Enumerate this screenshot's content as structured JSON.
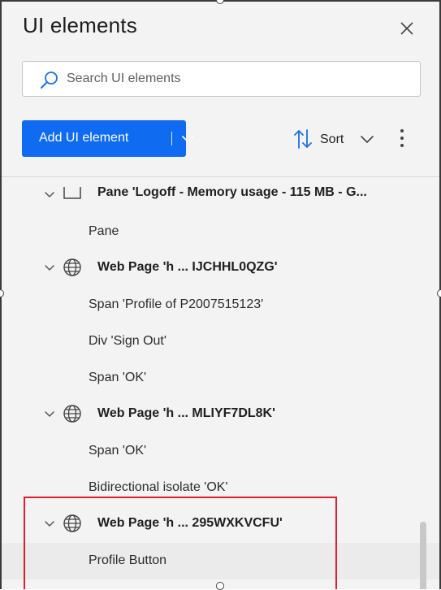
{
  "panel": {
    "title": "UI elements",
    "close_icon": "close-icon"
  },
  "search": {
    "placeholder": "Search UI elements",
    "value": "",
    "icon": "search-icon"
  },
  "toolbar": {
    "add_label": "Add UI element",
    "add_dropdown_icon": "chevron-down-icon",
    "sort_label": "Sort",
    "sort_icon": "sort-arrows-icon",
    "sort_dropdown_icon": "chevron-down-icon",
    "more_icon": "more-vertical-icon",
    "accent_color": "#0f6cf0"
  },
  "tree": {
    "rows": [
      {
        "kind": "parent",
        "icon": "pane-icon",
        "label": "Pane 'Logoff - Memory usage - 115 MB - G..."
      },
      {
        "kind": "child",
        "label": "Pane"
      },
      {
        "kind": "parent",
        "icon": "globe-icon",
        "label": "Web Page 'h ... IJCHHL0QZG'"
      },
      {
        "kind": "child",
        "label": "Span 'Profile of P2007515123'"
      },
      {
        "kind": "child",
        "label": "Div 'Sign Out'"
      },
      {
        "kind": "child",
        "label": "Span 'OK'"
      },
      {
        "kind": "parent",
        "icon": "globe-icon",
        "label": "Web Page 'h ... MLIYF7DL8K'"
      },
      {
        "kind": "child",
        "label": "Span 'OK'"
      },
      {
        "kind": "child",
        "label": "Bidirectional isolate 'OK'"
      },
      {
        "kind": "parent",
        "icon": "globe-icon",
        "label": "Web Page 'h ... 295WXKVCFU'"
      },
      {
        "kind": "child",
        "label": "Profile Button",
        "highlighted": true
      }
    ]
  },
  "annotation": {
    "color": "#e01f2e"
  }
}
